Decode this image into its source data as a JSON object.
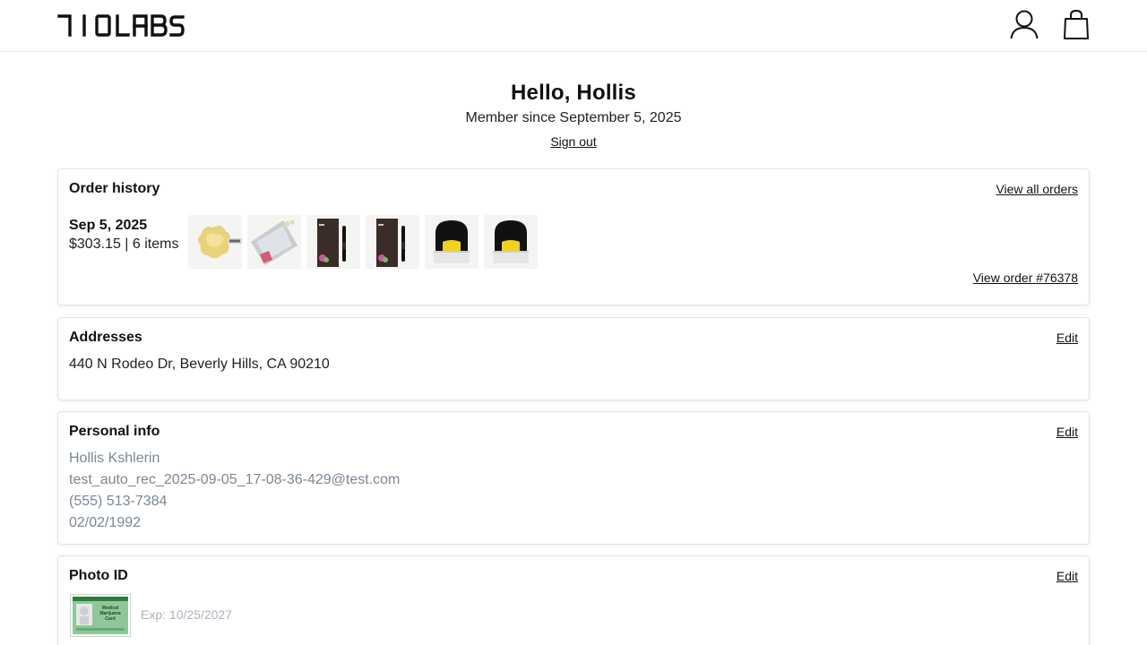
{
  "header": {
    "logo_text": "710LABS",
    "account_icon": "user-icon",
    "cart_icon": "shopping-bag-icon"
  },
  "profile": {
    "greeting": "Hello, Hollis",
    "member_since": "Member since September 5, 2025",
    "sign_out": "Sign out"
  },
  "order_history": {
    "title": "Order history",
    "view_all": "View all orders",
    "orders": [
      {
        "date": "Sep 5, 2025",
        "summary": "$303.15 | 6 items",
        "view_label": "View order #76378",
        "items": [
          {
            "icon": "concentrate-product-image"
          },
          {
            "icon": "foil-pouch-product-image"
          },
          {
            "icon": "vape-pen-box-product-image"
          },
          {
            "icon": "vape-pen-box-product-image"
          },
          {
            "icon": "pod-cartridge-product-image"
          },
          {
            "icon": "pod-cartridge-product-image"
          }
        ]
      }
    ]
  },
  "addresses": {
    "title": "Addresses",
    "edit": "Edit",
    "lines": [
      "440 N Rodeo Dr, Beverly Hills, CA 90210"
    ]
  },
  "personal_info": {
    "title": "Personal info",
    "edit": "Edit",
    "name": "Hollis Kshlerin",
    "email": "test_auto_rec_2025-09-05_17-08-36-429@test.com",
    "phone": "(555) 513-7384",
    "dob": "02/02/1992"
  },
  "photo_id": {
    "title": "Photo ID",
    "edit": "Edit",
    "card_title": "Medical Marijuana Card",
    "expiry": "Exp: 10/25/2027"
  },
  "colors": {
    "text": "#111111",
    "muted": "#7a8794",
    "faint": "#aab3bc",
    "border": "#e2e2e2",
    "card_green": "#8fc79a"
  }
}
